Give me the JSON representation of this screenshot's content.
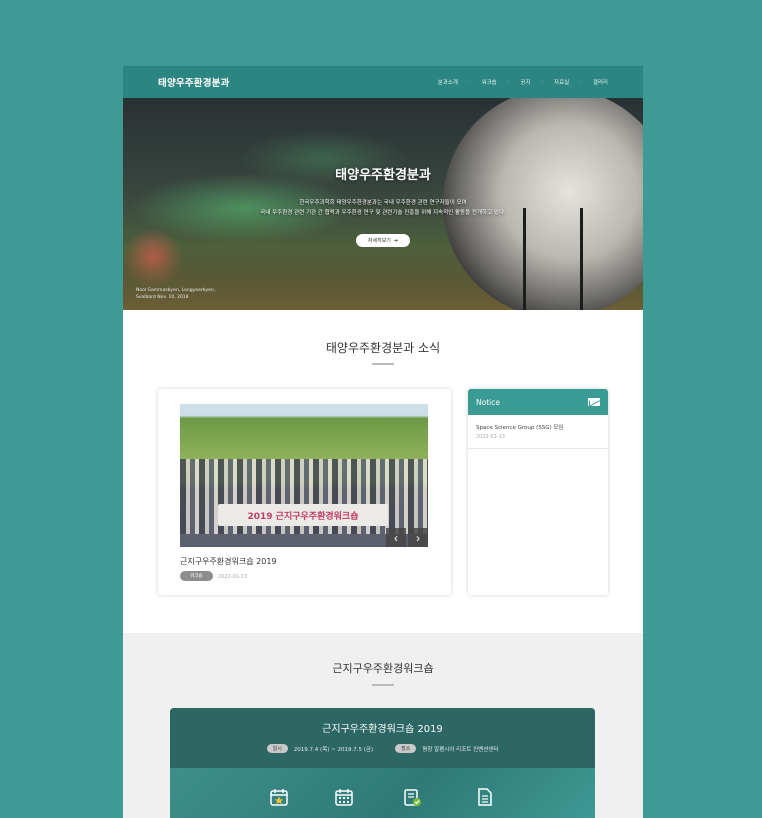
{
  "header": {
    "logo": "태양우주환경분과",
    "nav": [
      "분과소개",
      "워크숍",
      "공지",
      "자료실",
      "갤러리"
    ]
  },
  "hero": {
    "title": "태양우주환경분과",
    "desc_line1": "한국우주과학회 태양우주환경분과는 국내 우주환경 관련 연구자들이 모여",
    "desc_line2": "국내 우주환경 관련 기관 간 협력과 우주환경 연구 및 관련기술 진흥을 위해 지속적인 활동을 전개하고 있다.",
    "button": "자세히보기",
    "caption_line1": "Nool Gammasbyen, Longyearbyen,",
    "caption_line2": "Svalbard Nov. 10, 2018"
  },
  "news": {
    "section_title": "태양우주환경분과 소식",
    "banner_text": "2019 근지구우주환경워크숍",
    "item_title": "근지구우주환경워크숍 2019",
    "item_tag": "워크숍",
    "item_date": "2022-01-13",
    "prev": "‹",
    "next": "›"
  },
  "notice": {
    "title": "Notice",
    "items": [
      {
        "title": "Space Science Group (SSG) 모임",
        "date": "2022-01-13"
      }
    ]
  },
  "workshop": {
    "section_title": "근지구우주환경워크숍",
    "card_title": "근지구우주환경워크숍 2019",
    "date_label": "일시",
    "date_value": "2019.7.4 (목) ~ 2019.7.5 (금)",
    "place_label": "장소",
    "place_value": "평창 알펜시아 리조트 컨벤션센터"
  },
  "colors": {
    "background": "#3f9a95",
    "header": "#2b8580",
    "notice": "#3a9a94",
    "workshop_card": "#2d6764"
  }
}
